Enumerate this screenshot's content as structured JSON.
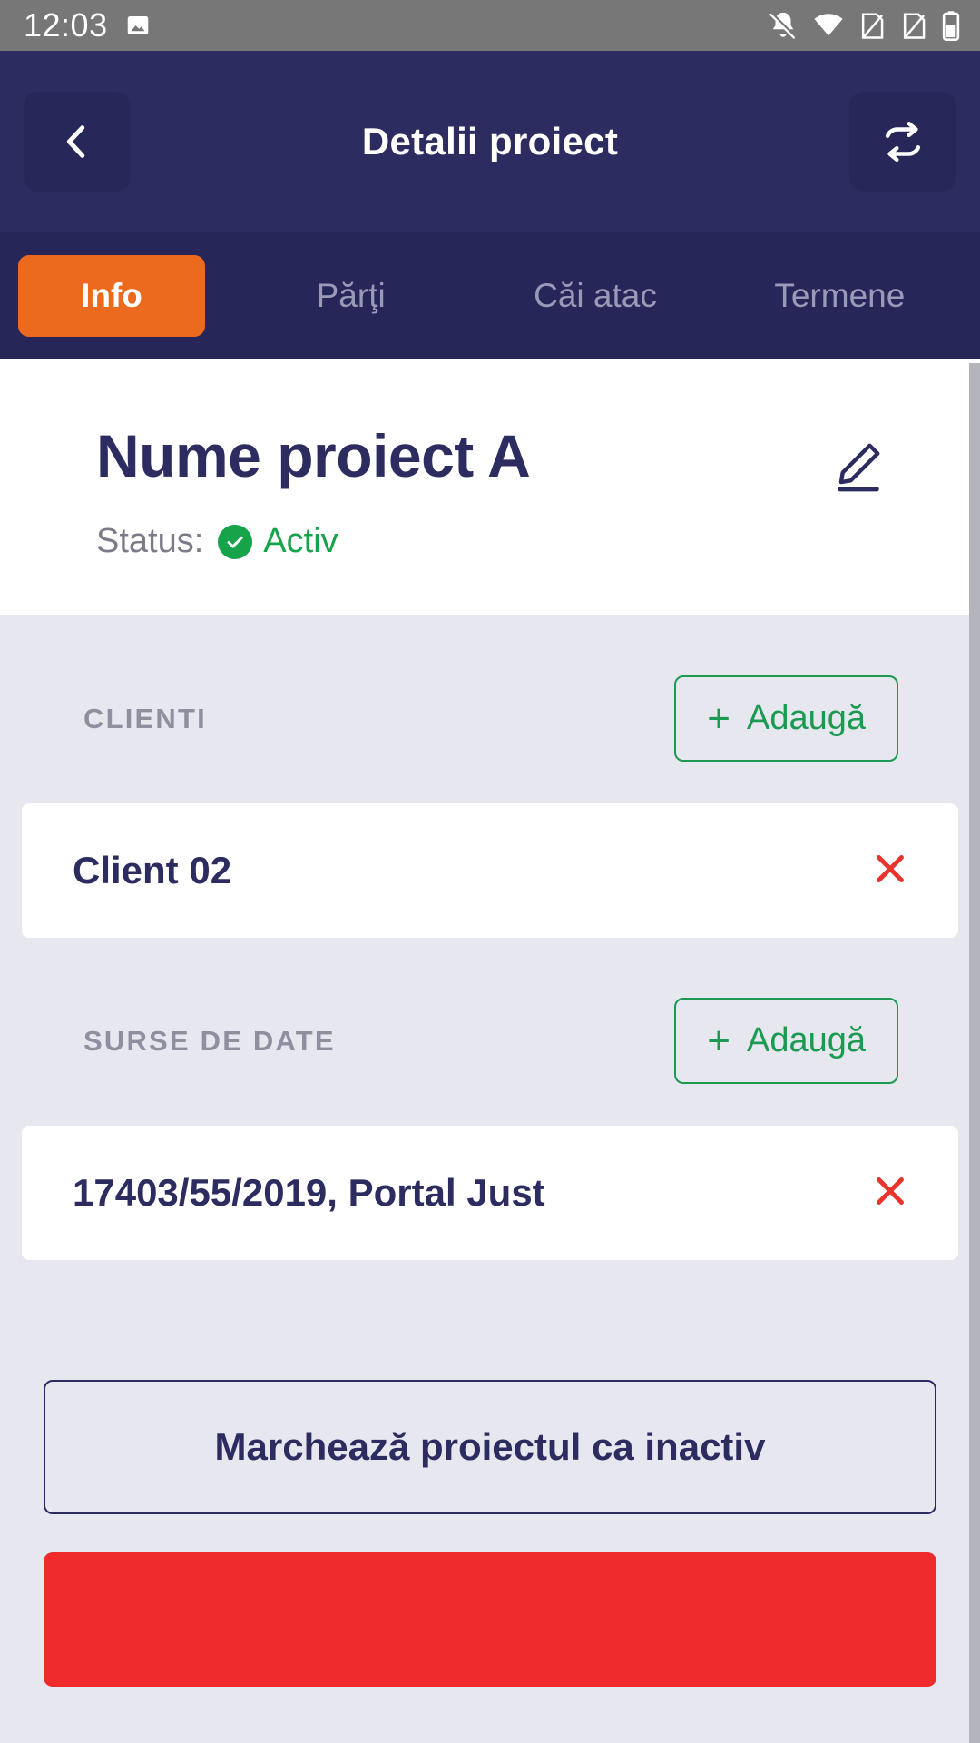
{
  "status_bar": {
    "time": "12:03",
    "left_icons": [
      "image-icon"
    ],
    "right_icons": [
      "notifications-off-icon",
      "wifi-icon",
      "sim-1-icon",
      "sim-2-icon",
      "battery-icon"
    ]
  },
  "app_bar": {
    "title": "Detalii proiect",
    "back_icon": "chevron-left-icon",
    "sync_icon": "sync-icon"
  },
  "tabs": [
    {
      "label": "Info",
      "active": true
    },
    {
      "label": "Părţi",
      "active": false
    },
    {
      "label": "Căi atac",
      "active": false
    },
    {
      "label": "Termene",
      "active": false
    }
  ],
  "project": {
    "name": "Nume proiect A",
    "status_label": "Status:",
    "status_value": "Activ",
    "status_icon": "check-circle-icon",
    "edit_icon": "pencil-icon"
  },
  "sections": [
    {
      "title": "CLIENTI",
      "add_label": "Adaugă",
      "add_icon": "plus-icon",
      "rows": [
        {
          "label": "Client 02",
          "remove_icon": "close-x-icon"
        }
      ]
    },
    {
      "title": "SURSE DE DATE",
      "add_label": "Adaugă",
      "add_icon": "plus-icon",
      "rows": [
        {
          "label": "17403/55/2019, Portal Just",
          "remove_icon": "close-x-icon"
        }
      ]
    }
  ],
  "actions": {
    "deactivate_label": "Marchează proiectul ca inactiv",
    "danger_label": ""
  },
  "colors": {
    "navy": "#2c2c60",
    "accent_orange": "#ec6a1e",
    "green": "#1d9a52",
    "status_green": "#16a34a",
    "danger_red": "#ef2b2b",
    "body_bg": "#e7e7f0",
    "muted": "#8f8f9f"
  }
}
